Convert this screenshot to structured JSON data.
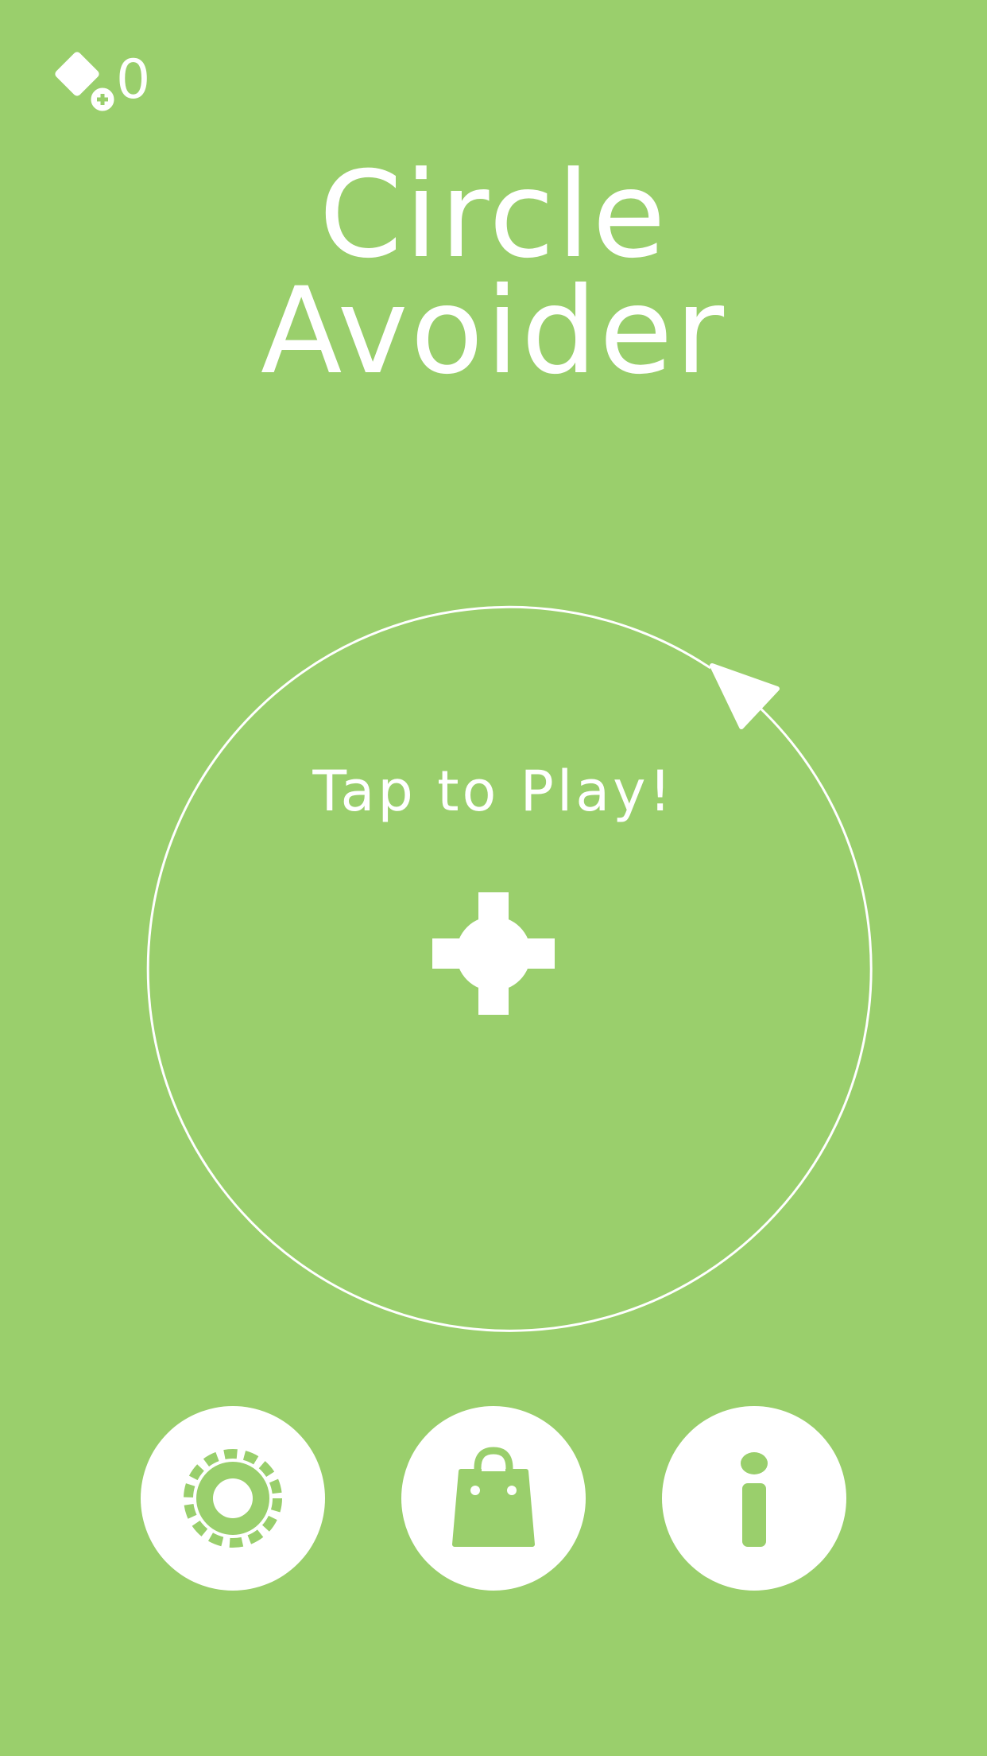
{
  "colors": {
    "background": "#9ACF6C",
    "foreground": "#FFFFFF"
  },
  "hud": {
    "gem_icon": "gem-plus-icon",
    "gem_count": "0"
  },
  "title": {
    "line1": "Circle",
    "line2": "Avoider"
  },
  "play_area": {
    "prompt": "Tap to Play!",
    "player_icon": "cross-circle-player-icon",
    "arrow_icon": "triangle-arrow-icon"
  },
  "menu": {
    "buttons": [
      {
        "id": "settings",
        "icon": "gear-icon"
      },
      {
        "id": "shop",
        "icon": "shopping-bag-icon"
      },
      {
        "id": "info",
        "icon": "info-icon"
      }
    ]
  }
}
